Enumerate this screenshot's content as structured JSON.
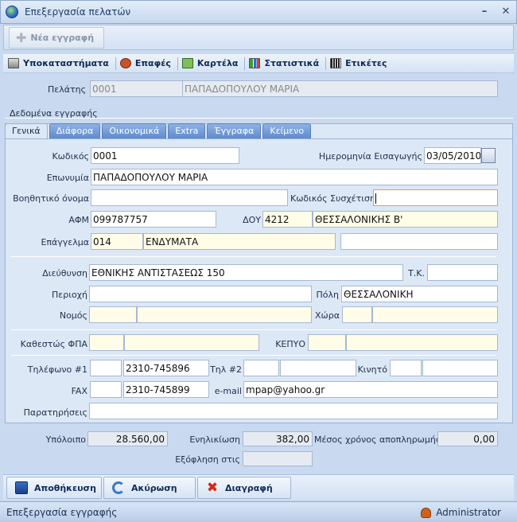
{
  "window": {
    "title": "Επεξεργασία πελατών",
    "minimize": "–",
    "close": "✕"
  },
  "toolbar": {
    "new_record": "Νέα εγγραφή"
  },
  "nav": [
    {
      "label": "Υποκαταστήματα",
      "icon": "database-icon"
    },
    {
      "label": "Επαφές",
      "icon": "contacts-icon"
    },
    {
      "label": "Καρτέλα",
      "icon": "card-icon"
    },
    {
      "label": "Στατιστικά",
      "icon": "chart-icon"
    },
    {
      "label": "Ετικέτες",
      "icon": "barcode-icon"
    }
  ],
  "customer": {
    "label": "Πελάτης",
    "code": "0001",
    "name": "ΠΑΠΑΔΟΠΟΥΛΟΥ ΜΑΡΙΑ"
  },
  "section_title": "Δεδομένα εγγραφής",
  "tabs": [
    "Γενικά",
    "Διάφορα",
    "Οικονομικά",
    "Extra",
    "Έγγραφα",
    "Κείμενο"
  ],
  "form": {
    "code_label": "Κωδικός",
    "code": "0001",
    "date_label": "Ημερομηνία Εισαγωγής",
    "date": "03/05/2010",
    "name_label": "Επωνυμία",
    "name": "ΠΑΠΑΔΟΠΟΥΛΟΥ ΜΑΡΙΑ",
    "alias_label": "Βοηθητικό όνομα",
    "alias": "",
    "relcode_label": "Κωδικός Συσχέτισης",
    "relcode": "",
    "afm_label": "ΑΦΜ",
    "afm": "099787757",
    "doy_label": "ΔΟΥ",
    "doy_code": "4212",
    "doy_name": "ΘΕΣΣΑΛΟΝΙΚΗΣ Β'",
    "job_label": "Επάγγελμα",
    "job_code": "014",
    "job_name": "ΕΝΔΥΜΑΤΑ",
    "job_extra": "",
    "address_label": "Διεύθυνση",
    "address": "ΕΘΝΙΚΗΣ ΑΝΤΙΣΤΑΣΕΩΣ 150",
    "zip_label": "Τ.Κ.",
    "zip": "",
    "area_label": "Περιοχή",
    "area": "",
    "city_label": "Πόλη",
    "city": "ΘΕΣΣΑΛΟΝΙΚΗ",
    "prefecture_label": "Νομός",
    "prefecture_code": "",
    "prefecture_name": "",
    "country_label": "Χώρα",
    "country_code": "",
    "country_name": "",
    "vat_label": "Καθεστώς ΦΠΑ",
    "vat_code": "",
    "vat_name": "",
    "kepyo_label": "ΚΕΠΥΟ",
    "kepyo_code": "",
    "kepyo_name": "",
    "phone1_label": "Τηλέφωνο #1",
    "phone1_prefix": "",
    "phone1": "2310-745896",
    "phone2_label": "Τηλ #2",
    "phone2_prefix": "",
    "phone2": "",
    "mobile_label": "Κινητό",
    "mobile_prefix": "",
    "mobile": "",
    "fax_label": "FAX",
    "fax_prefix": "",
    "fax": "2310-745899",
    "email_label": "e-mail",
    "email": "mpap@yahoo.gr",
    "notes_label": "Παρατηρήσεις",
    "notes": ""
  },
  "summary": {
    "balance_label": "Υπόλοιπο",
    "balance": "28.560,00",
    "aging_label": "Ενηλικίωση",
    "aging": "382,00",
    "avg_label": "Μέσος χρόνος αποπληρωμής",
    "avg": "0,00",
    "payoff_label": "Εξόφληση στις",
    "payoff": ""
  },
  "actions": {
    "save": "Αποθήκευση",
    "cancel": "Ακύρωση",
    "delete": "Διαγραφή"
  },
  "status": {
    "text": "Επεξεργασία εγγραφής",
    "user": "Administrator"
  }
}
